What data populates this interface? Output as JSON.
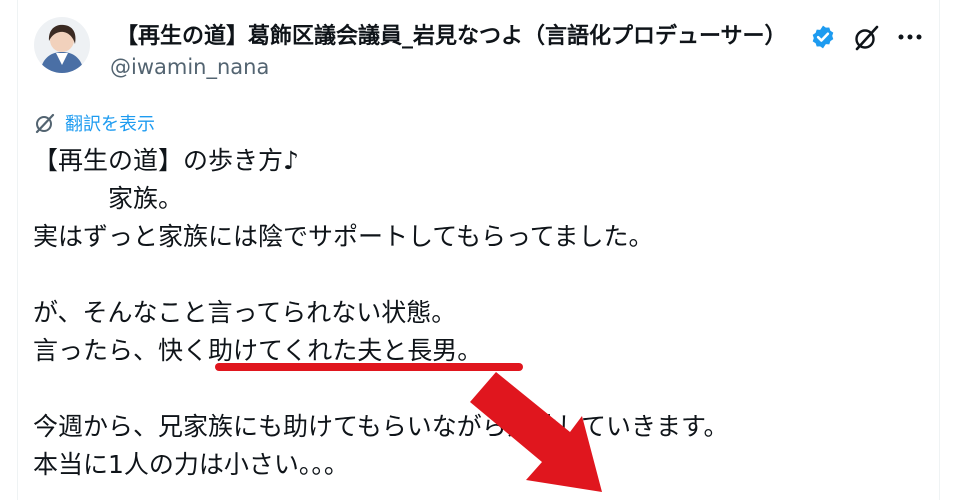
{
  "post": {
    "display_name": "【再生の道】葛飾区議会議員_岩見なつよ（言語化プロデューサー）",
    "handle": "@iwamin_nana",
    "translate_label": "翻訳を表示",
    "lines": [
      "【再生の道】の歩き方♪",
      "　　　家族。",
      "実はずっと家族には陰でサポートしてもらってました。",
      "",
      "が、そんなこと言ってられない状態。",
      "言ったら、快く助けてくれた夫と長男。",
      "",
      "今週から、兄家族にも助けてもらいながら活動していきます。",
      "本当に1人の力は小さい。。。"
    ]
  },
  "icons": {
    "verified": "verified-badge-icon",
    "grok": "grok-icon",
    "more": "more-options-icon",
    "translate": "translate-icon"
  },
  "colors": {
    "accent": "#1d9bf0",
    "annotation_red": "#e0161e"
  }
}
